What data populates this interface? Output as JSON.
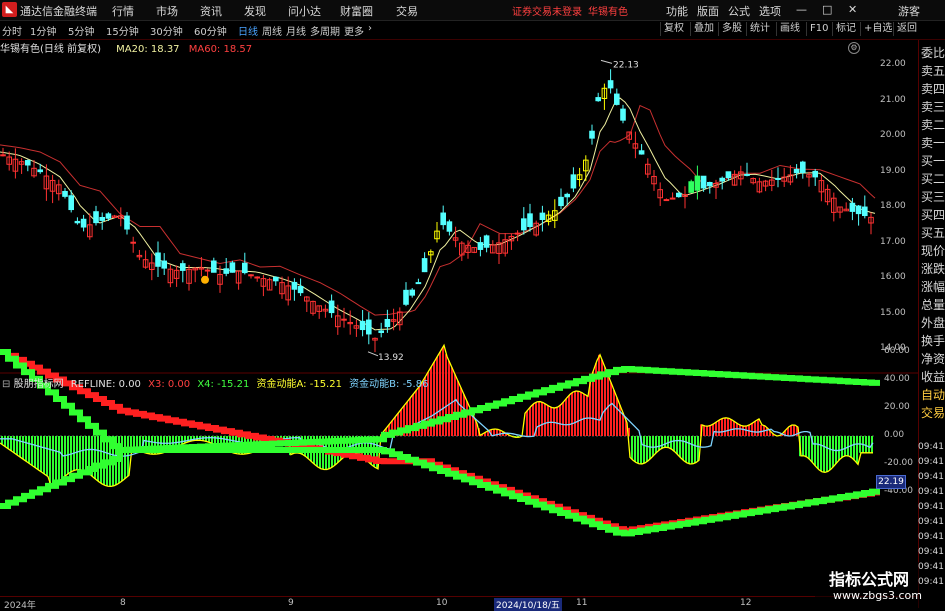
{
  "menubar": {
    "app_title": "通达信金融终端",
    "menus": [
      "行情",
      "市场",
      "资讯",
      "发现",
      "问小达",
      "财富圈",
      "交易"
    ],
    "warning": "证券交易未登录",
    "stock_name": "华锡有色",
    "right_menus": [
      "功能",
      "版面",
      "公式",
      "选项"
    ],
    "guest": "游客",
    "win_buttons": [
      "—",
      "□",
      "✕"
    ]
  },
  "periodbar": {
    "periods": [
      "分时",
      "1分钟",
      "5分钟",
      "15分钟",
      "30分钟",
      "60分钟",
      "日线",
      "周线",
      "月线",
      "多周期",
      "更多"
    ],
    "active_period": "日线",
    "tools": [
      "复权",
      "叠加",
      "多股",
      "统计",
      "画线",
      "F10",
      "标记",
      "+自选",
      "返回"
    ]
  },
  "main_chart": {
    "title": "华锡有色(日线 前复权)",
    "ma20_label": "MA20: 18.37",
    "ma60_label": "MA60: 18.57",
    "high_label": "22.13",
    "low_label": "13.92",
    "y_ticks": [
      "22.00",
      "21.00",
      "20.00",
      "19.00",
      "18.00",
      "17.00",
      "16.00",
      "15.00",
      "14.00"
    ],
    "y_values": [
      22,
      21,
      20,
      19,
      18,
      17,
      16,
      15,
      14
    ],
    "colors": {
      "up": "#ff3232",
      "down": "#54ffff",
      "yellow": "#ffff00",
      "ma20": "#f0f0a0",
      "ma60": "#c83030"
    }
  },
  "indicator": {
    "name": "股朋指标网",
    "refline": "REFLINE: 0.00",
    "x3": "X3: 0.00",
    "x4": "X4: -15.21",
    "a": "资金动能A: -15.21",
    "b": "资金动能B: -5.86",
    "y_ticks": [
      "60.00",
      "40.00",
      "20.00",
      "0.00",
      "-20.00",
      "-40.00"
    ],
    "y_values": [
      60,
      40,
      20,
      0,
      -20,
      -40
    ],
    "cursor_value": "22.19",
    "colors": {
      "pos": "#ff2020",
      "neg": "#30ff30",
      "line_yellow": "#ffff00",
      "line_blue": "#7fd4ff"
    }
  },
  "right_panel": {
    "items": [
      "委比",
      "卖五",
      "卖四",
      "卖三",
      "卖二",
      "卖一",
      "买一",
      "买二",
      "买三",
      "买四",
      "买五",
      "现价",
      "涨跌",
      "涨幅",
      "总量",
      "外盘",
      "换手",
      "净资",
      "收益",
      "自动",
      "交易"
    ],
    "times": [
      "09:41",
      "09:41",
      "09:41",
      "09:41",
      "09:41",
      "09:41",
      "09:41",
      "09:41",
      "09:41",
      "09:41"
    ]
  },
  "datebar": {
    "labels": [
      "2024年",
      "8",
      "9",
      "10",
      "2024/10/18/五",
      "11",
      "12"
    ]
  },
  "watermark": {
    "brand": "指标公式网",
    "site": "www.zbgs3.com"
  }
}
